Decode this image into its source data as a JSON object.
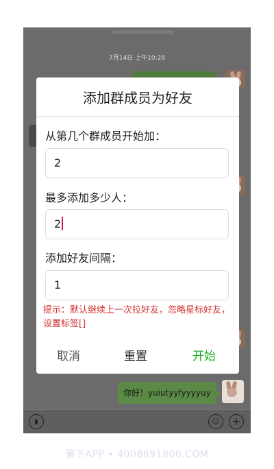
{
  "chat": {
    "timestamp": "7月14日 上午10:28",
    "message": "你好！yuiutyyfyyyyuy"
  },
  "dialog": {
    "title": "添加群成员为好友",
    "fields": [
      {
        "label": "从第几个群成员开始加：",
        "value": "2"
      },
      {
        "label": "最多添加多少人：",
        "value": "2"
      },
      {
        "label": "添加好友间隔：",
        "value": "1"
      }
    ],
    "tip": "提示：默认继续上一次拉好友，忽略星标好友，设置标签[]",
    "buttons": {
      "cancel": "取消",
      "reset": "重置",
      "start": "开始"
    },
    "colors": {
      "accent": "#1aad19",
      "tip": "#d32f2f",
      "caret": "#d81b60"
    }
  },
  "bottom_bar": {
    "icons": [
      "voice-icon",
      "emoji-icon",
      "plus-icon"
    ]
  },
  "watermark": "第下APP • 4008891800.COM"
}
